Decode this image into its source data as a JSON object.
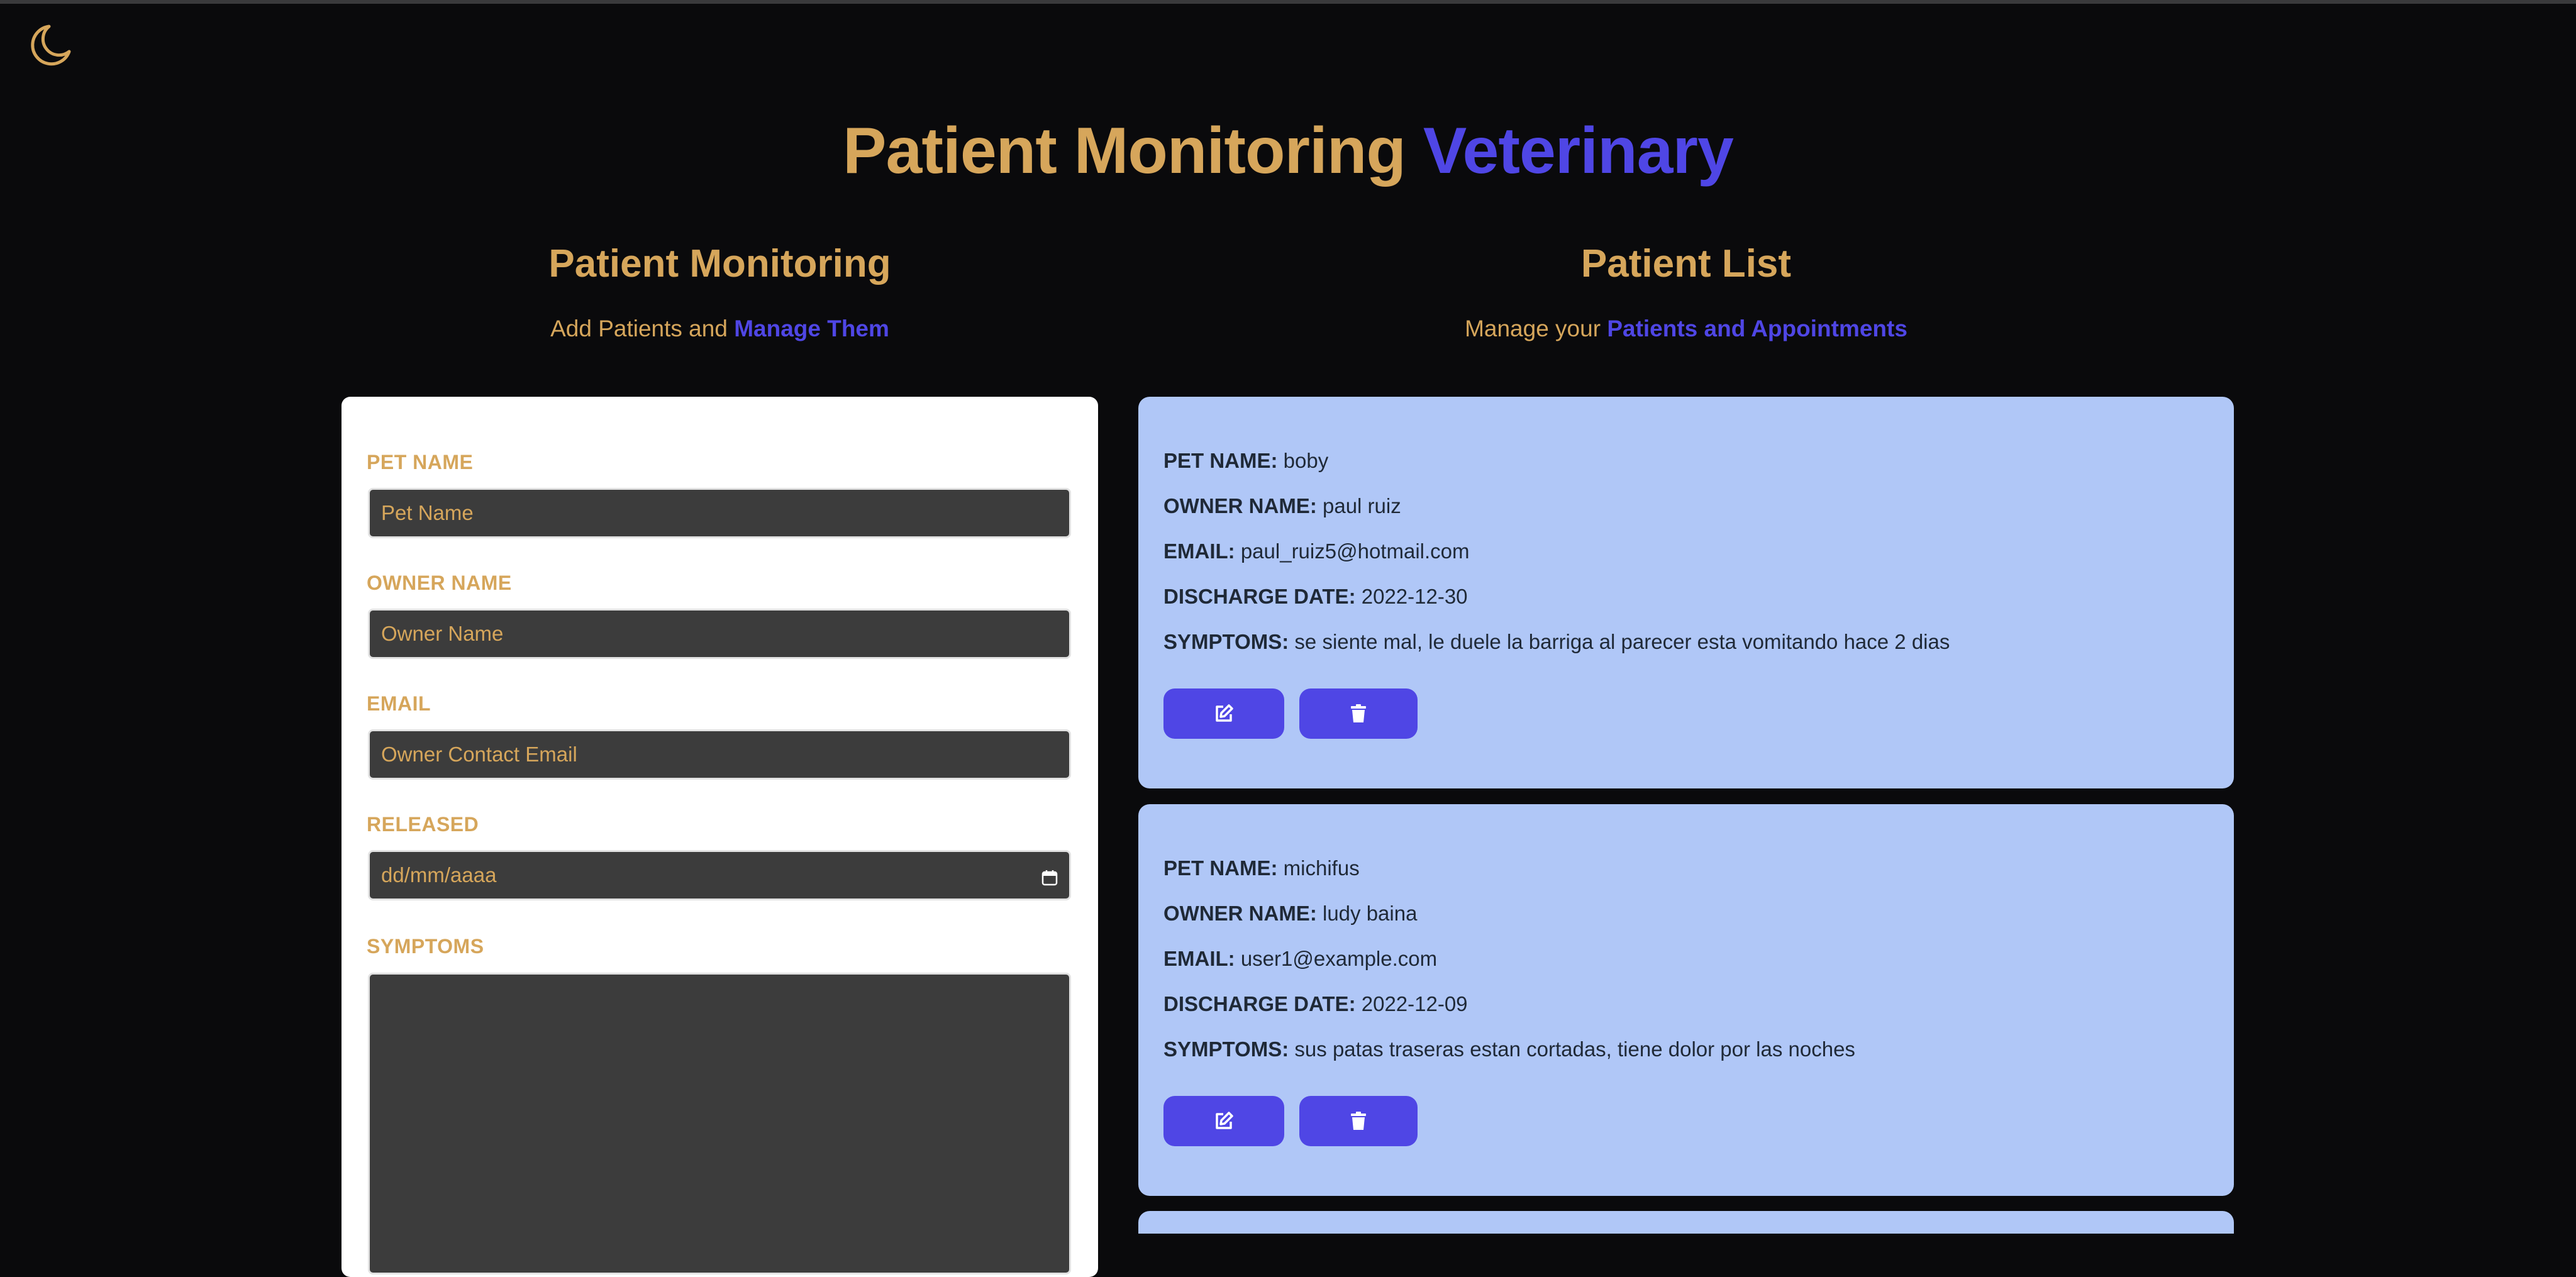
{
  "header": {
    "title_part1": "Patient Monitoring",
    "title_part2": "Veterinary",
    "theme_icon": "moon-icon"
  },
  "form_section": {
    "title": "Patient Monitoring",
    "subtitle_prefix": "Add Patients and",
    "subtitle_highlight": "Manage Them"
  },
  "list_section": {
    "title": "Patient List",
    "subtitle_prefix": "Manage your",
    "subtitle_highlight": "Patients and Appointments"
  },
  "form": {
    "pet_name_label": "PET NAME",
    "pet_name_placeholder": "Pet Name",
    "owner_name_label": "OWNER NAME",
    "owner_name_placeholder": "Owner Name",
    "email_label": "EMAIL",
    "email_placeholder": "Owner Contact Email",
    "released_label": "RELEASED",
    "released_placeholder": "dd/mm/aaaa",
    "symptoms_label": "SYMPTOMS",
    "symptoms_value": ""
  },
  "labels": {
    "pet_name": "PET NAME:",
    "owner_name": "OWNER NAME:",
    "email": "EMAIL:",
    "discharge_date": "DISCHARGE DATE:",
    "symptoms": "SYMPTOMS:"
  },
  "patients": [
    {
      "pet_name": "boby",
      "owner_name": "paul ruiz",
      "email": "paul_ruiz5@hotmail.com",
      "discharge_date": "2022-12-30",
      "symptoms": "se siente mal, le duele la barriga al parecer esta vomitando hace 2 dias",
      "edit_icon": "edit-icon",
      "delete_icon": "trash-icon"
    },
    {
      "pet_name": "michifus",
      "owner_name": "ludy baina",
      "email": "user1@example.com",
      "discharge_date": "2022-12-09",
      "symptoms": "sus patas traseras estan cortadas, tiene dolor por las noches",
      "edit_icon": "edit-icon",
      "delete_icon": "trash-icon"
    }
  ],
  "colors": {
    "background": "#0a0a0c",
    "accent_gold": "#d6a65b",
    "accent_indigo": "#4f46e5",
    "card_blue": "#b0c7f7",
    "form_card": "#ffffff",
    "input_bg": "#3c3c3c"
  }
}
